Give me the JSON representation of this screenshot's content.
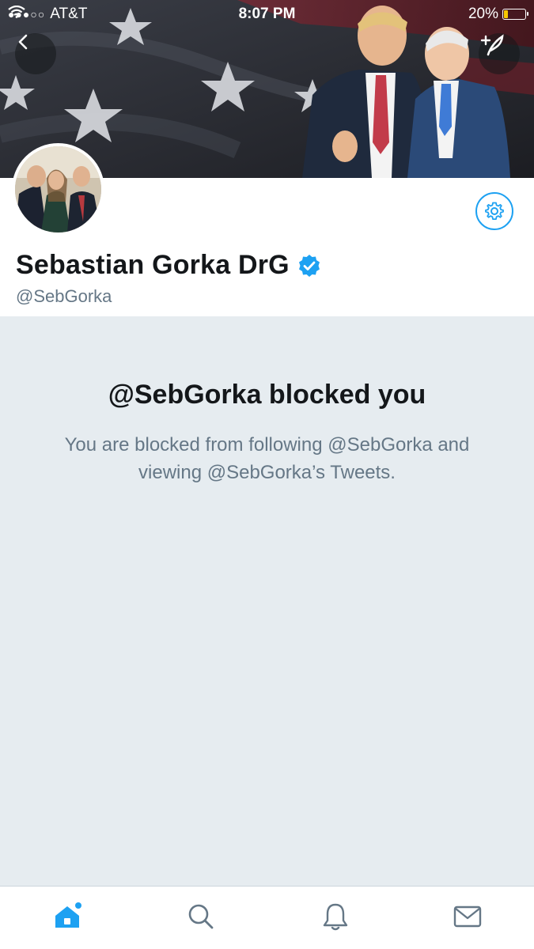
{
  "status_bar": {
    "carrier": "AT&T",
    "signal_dots": "●●●○○",
    "time": "8:07 PM",
    "battery_percent": "20%",
    "battery_level": 0.2
  },
  "header": {
    "back_icon": "chevron-left-icon",
    "compose_icon": "compose-tweet-icon"
  },
  "profile": {
    "display_name": "Sebastian Gorka DrG",
    "verified": true,
    "handle": "@SebGorka",
    "settings_icon": "gear-icon"
  },
  "blocked": {
    "title": "@SebGorka blocked you",
    "description": "You are blocked from following @SebGorka and viewing @SebGorka’s Tweets."
  },
  "tabbar": {
    "items": [
      {
        "name": "home",
        "icon": "home-icon",
        "active": true
      },
      {
        "name": "search",
        "icon": "search-icon",
        "active": false
      },
      {
        "name": "notifications",
        "icon": "bell-icon",
        "active": false
      },
      {
        "name": "messages",
        "icon": "mail-icon",
        "active": false
      }
    ]
  },
  "colors": {
    "accent": "#1da1f2",
    "background": "#e6ecf0",
    "text_primary": "#14171a",
    "text_secondary": "#657786"
  }
}
